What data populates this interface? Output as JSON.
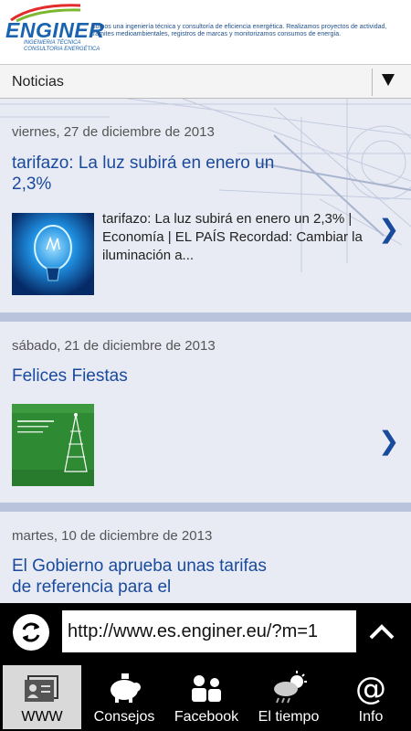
{
  "header": {
    "logo": "ENGINER",
    "logo_sub1": "INGENIERIA TÉCNICA",
    "logo_sub2": "CONSULTORIA ENERGÉTICA",
    "description": "Somos una ingeniería técnica y consultoría de eficiencia energética. Realizamos proyectos de actividad, trámites medioambientales, registros de marcas y monitorizamos consumos de energía."
  },
  "dropdown": {
    "selected": "Noticias"
  },
  "posts": [
    {
      "date": "viernes, 27 de diciembre de 2013",
      "title": "tarifazo: La luz subirá en enero un 2,3%",
      "excerpt": "tarifazo: La luz subirá en enero un 2,3% | Economía | EL PAÍS Recordad: Cambiar la iluminación a...",
      "thumb_icon": "lightbulb-image"
    },
    {
      "date": "sábado, 21 de diciembre de 2013",
      "title": "Felices Fiestas",
      "excerpt": "",
      "thumb_icon": "christmas-card-image"
    },
    {
      "date": "martes, 10 de diciembre de 2013",
      "title": "El Gobierno aprueba unas tarifas de referencia para el",
      "excerpt": ""
    }
  ],
  "chevron": "❯",
  "urlbar": {
    "url": "http://www.es.enginer.eu/?m=1"
  },
  "tabs": [
    {
      "label": "WWW",
      "icon": "id-card-icon",
      "active": true
    },
    {
      "label": "Consejos",
      "icon": "piggy-bank-icon",
      "active": false
    },
    {
      "label": "Facebook",
      "icon": "people-icon",
      "active": false
    },
    {
      "label": "El tiempo",
      "icon": "weather-icon",
      "active": false
    },
    {
      "label": "Info",
      "icon": "at-sign-icon",
      "active": false
    }
  ],
  "colors": {
    "accent": "#1a4a9c",
    "logo": "#1a63b0",
    "divider": "#b9c3dc"
  }
}
